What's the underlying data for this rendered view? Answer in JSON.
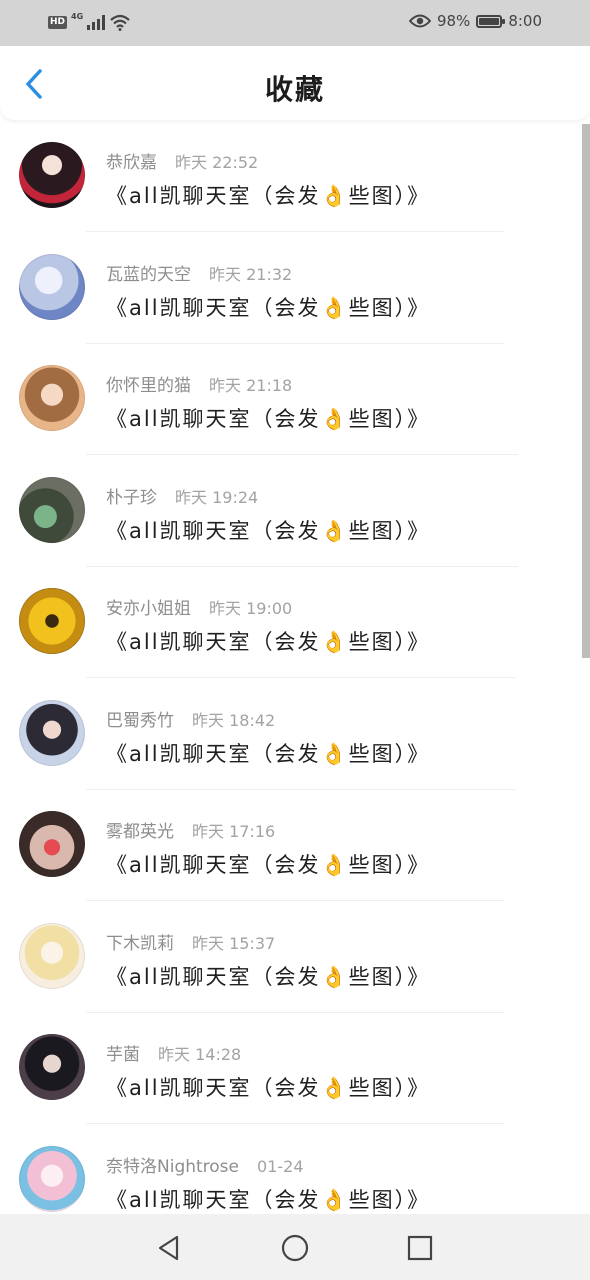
{
  "status_bar": {
    "hd_label": "HD",
    "network_label": "4G",
    "battery_percent": "98%",
    "battery_level": 0.98,
    "time": "8:00"
  },
  "header": {
    "back_icon": "chevron-left-icon",
    "title": "收藏",
    "accent_color": "#2d8fe3"
  },
  "favorites": [
    {
      "name": "恭欣嘉",
      "time": "昨天 22:52",
      "message": "《all凯聊天室（会发👌些图）》"
    },
    {
      "name": "瓦蓝的天空",
      "time": "昨天 21:32",
      "message": "《all凯聊天室（会发👌些图）》"
    },
    {
      "name": "你怀里的猫",
      "time": "昨天 21:18",
      "message": "《all凯聊天室（会发👌些图）》"
    },
    {
      "name": "朴子珍",
      "time": "昨天 19:24",
      "message": "《all凯聊天室（会发👌些图）》"
    },
    {
      "name": "安亦小姐姐",
      "time": "昨天 19:00",
      "message": "《all凯聊天室（会发👌些图）》"
    },
    {
      "name": "巴蜀秀竹",
      "time": "昨天 18:42",
      "message": "《all凯聊天室（会发👌些图）》"
    },
    {
      "name": "雾都英光",
      "time": "昨天 17:16",
      "message": "《all凯聊天室（会发👌些图）》"
    },
    {
      "name": "下木凯莉",
      "time": "昨天 15:37",
      "message": "《all凯聊天室（会发👌些图）》"
    },
    {
      "name": "芋菌",
      "time": "昨天 14:28",
      "message": "《all凯聊天室（会发👌些图）》"
    },
    {
      "name": "奈特洛Nightrose",
      "time": "01-24",
      "message": "《all凯聊天室（会发👌些图）》"
    }
  ],
  "nav_bar": {
    "back_icon": "triangle-back-icon",
    "home_icon": "circle-home-icon",
    "recents_icon": "square-recents-icon"
  }
}
